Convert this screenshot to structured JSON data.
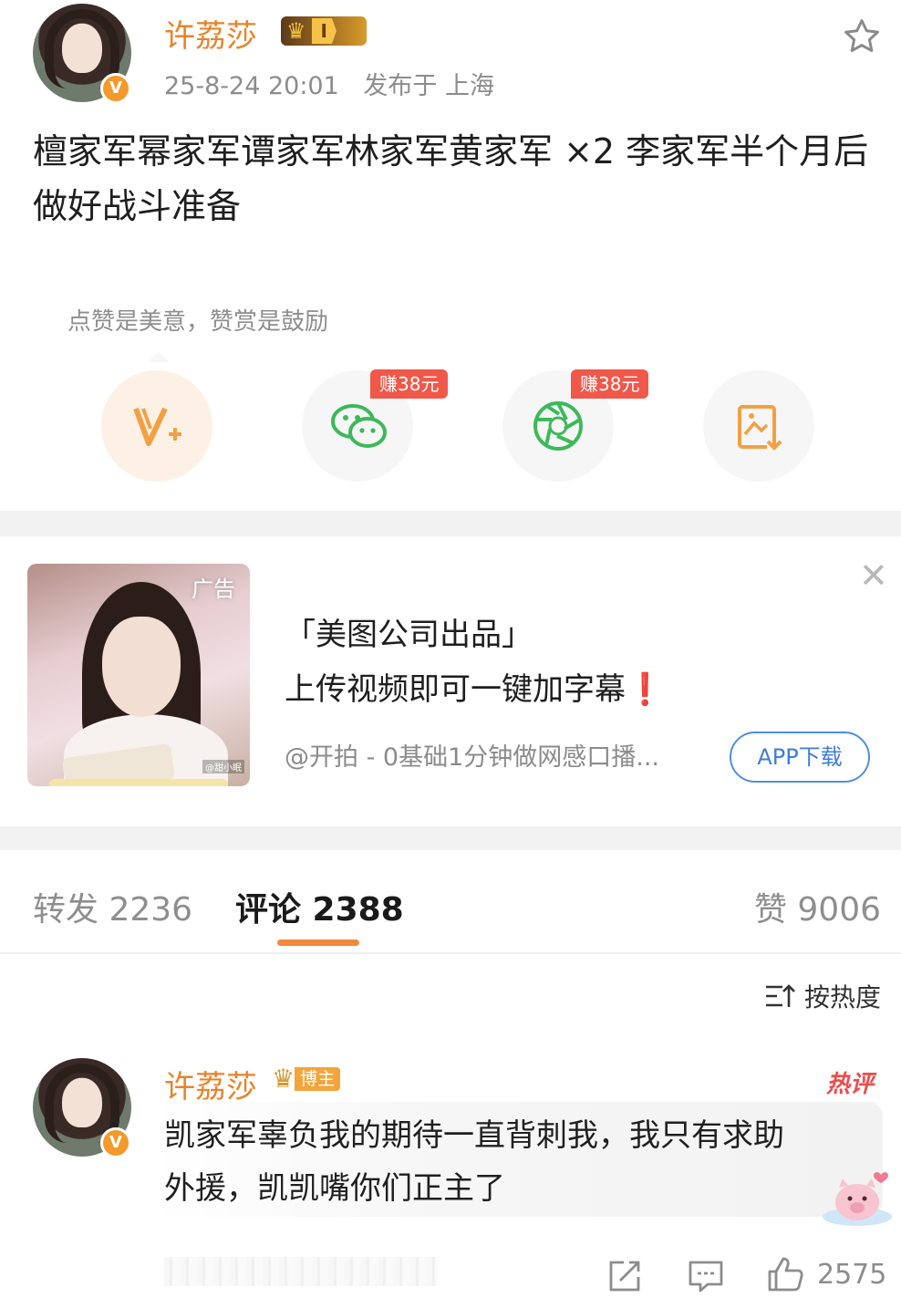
{
  "post": {
    "author": "许荔莎",
    "level": "I",
    "timestamp": "25-8-24 20:01",
    "location": "发布于 上海",
    "text": "檀家军幂家军谭家军林家军黄家军 ×2 李家军半个月后做好战斗准备"
  },
  "reward": {
    "tip": "点赞是美意，赞赏是鼓励",
    "items": [
      {
        "icon": "v-plus-icon",
        "earn": ""
      },
      {
        "icon": "wechat-icon",
        "earn": "赚38元"
      },
      {
        "icon": "moments-icon",
        "earn": "赚38元"
      },
      {
        "icon": "save-image-icon",
        "earn": ""
      }
    ]
  },
  "ad": {
    "tag": "广告",
    "watermark": "@甜小眠",
    "line1": "「美图公司出品」",
    "line2": "上传视频即可一键加字幕",
    "exclaim": "❗",
    "sub": "@开拍 - 0基础1分钟做网感口播...",
    "button": "APP下载"
  },
  "tabs": {
    "repost": "转发 2236",
    "comment": "评论 2388",
    "like": "赞 9006"
  },
  "sort_label": "按热度",
  "comment": {
    "author": "许荔莎",
    "badge": "博主",
    "hot": "热评",
    "text_line1": "凯家军辜负我的期待一直背刺我，我只有求助",
    "text_line2": "外援，凯凯嘴你们正主了",
    "likes": "2575"
  },
  "colors": {
    "brand_orange": "#e8842a",
    "earn_red": "#f0584a",
    "link_blue": "#3d7ed8",
    "wechat_green": "#3cb95a"
  }
}
